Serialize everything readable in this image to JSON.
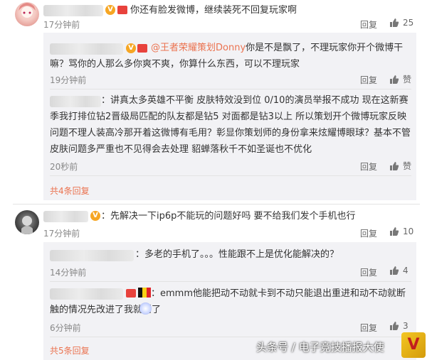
{
  "comments": [
    {
      "text": "你还有脸发微博，继续装死不回复玩家啊",
      "time": "17分钟前",
      "reply_label": "回复",
      "likes": "25",
      "replies": [
        {
          "mention": "@王者荣耀策划Donny",
          "text": "你是不是飘了，不理玩家你开个微博干嘛？骂你的人那么多你爽不爽，你算什么东西，可以不理玩家",
          "time": "19分钟前",
          "reply_label": "回复",
          "like_label": "赞"
        },
        {
          "text": "：讲真太多英雄不平衡 皮肤特效没到位 0/10的演员举报不成功 现在这新赛季我打排位钻2晋级局匹配的队友都是钻5 对面都是钻3以上 所以策划开个微博玩家反映问题不理人装高冷那开着这微博有毛用？彰显你策划师的身份拿来炫耀博眼球？基本不管皮肤问题多严重也不见得会去处理 貂蝉落秋千不如圣诞也不优化",
          "time": "20秒前",
          "reply_label": "回复",
          "like_label": "赞"
        }
      ],
      "more_label": "共4条回复"
    },
    {
      "text": "：先解决一下ip6p不能玩的问题好吗 要不给我们发个手机也行",
      "time": "17分钟前",
      "reply_label": "回复",
      "likes": "10",
      "replies": [
        {
          "text": "：多老的手机了。。。性能跟不上是优化能解决的？",
          "time": "14分钟前",
          "reply_label": "回复",
          "likes": "4"
        },
        {
          "text": "：emmm他能把动不动就卡到不动只能退出重进和动不动就断触的情况先改进了我就谢了",
          "time": "6分钟前",
          "reply_label": "回复",
          "likes": "3"
        }
      ],
      "more_label": "共5条回复"
    }
  ],
  "watermark": "头条号 / 电子竞技播报大使",
  "icons": {
    "like": "thumbs-up-icon",
    "verified": "v-badge-icon",
    "level": "level-badge-icon"
  },
  "colors": {
    "link": "#eb7350",
    "subbox_bg": "#f2f2f5",
    "verified": "#f6a623"
  }
}
